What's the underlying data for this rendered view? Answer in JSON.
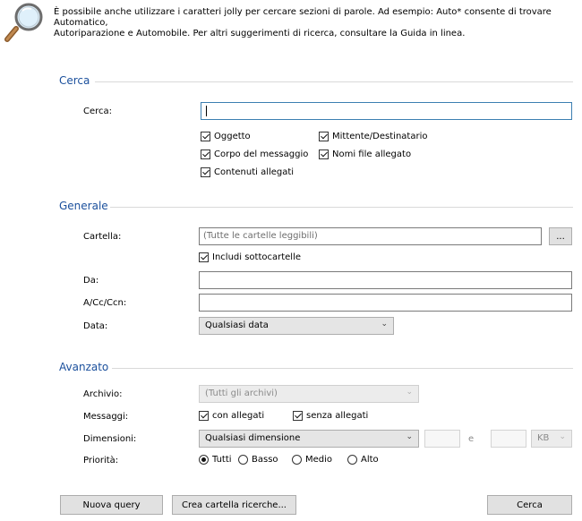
{
  "hint": {
    "line1": "È possibile anche utilizzare i caratteri jolly per cercare sezioni di parole. Ad esempio: Auto* consente di trovare Automatico,",
    "line2": "Autoriparazione e Automobile. Per altri suggerimenti di ricerca, consultare la Guida in linea."
  },
  "cerca_section": {
    "title": "Cerca",
    "search_label": "Cerca:",
    "search_value": "",
    "checkboxes": [
      {
        "label": "Oggetto",
        "checked": true
      },
      {
        "label": "Mittente/Destinatario",
        "checked": true
      },
      {
        "label": "Corpo del messaggio",
        "checked": true
      },
      {
        "label": "Nomi file allegato",
        "checked": true
      },
      {
        "label": "Contenuti allegati",
        "checked": true
      }
    ]
  },
  "generale": {
    "title": "Generale",
    "folder_label": "Cartella:",
    "folder_placeholder": "(Tutte le cartelle leggibili)",
    "browse_label": "...",
    "include_subfolders": "Includi sottocartelle",
    "from_label": "Da:",
    "to_label": "A/Cc/Ccn:",
    "date_label": "Data:",
    "date_value": "Qualsiasi data"
  },
  "avanzato": {
    "title": "Avanzato",
    "archive_label": "Archivio:",
    "archive_value": "(Tutti gli archivi)",
    "messages_label": "Messaggi:",
    "with_attachments": "con allegati",
    "without_attachments": "senza allegati",
    "size_label": "Dimensioni:",
    "size_value": "Qualsiasi dimensione",
    "size_and": "e",
    "size_unit": "KB",
    "priority_label": "Priorità:",
    "priority_options": [
      "Tutti",
      "Basso",
      "Medio",
      "Alto"
    ],
    "priority_selected": "Tutti"
  },
  "footer": {
    "new_query": "Nuova query",
    "create_folder": "Crea cartella ricerche...",
    "search": "Cerca"
  }
}
